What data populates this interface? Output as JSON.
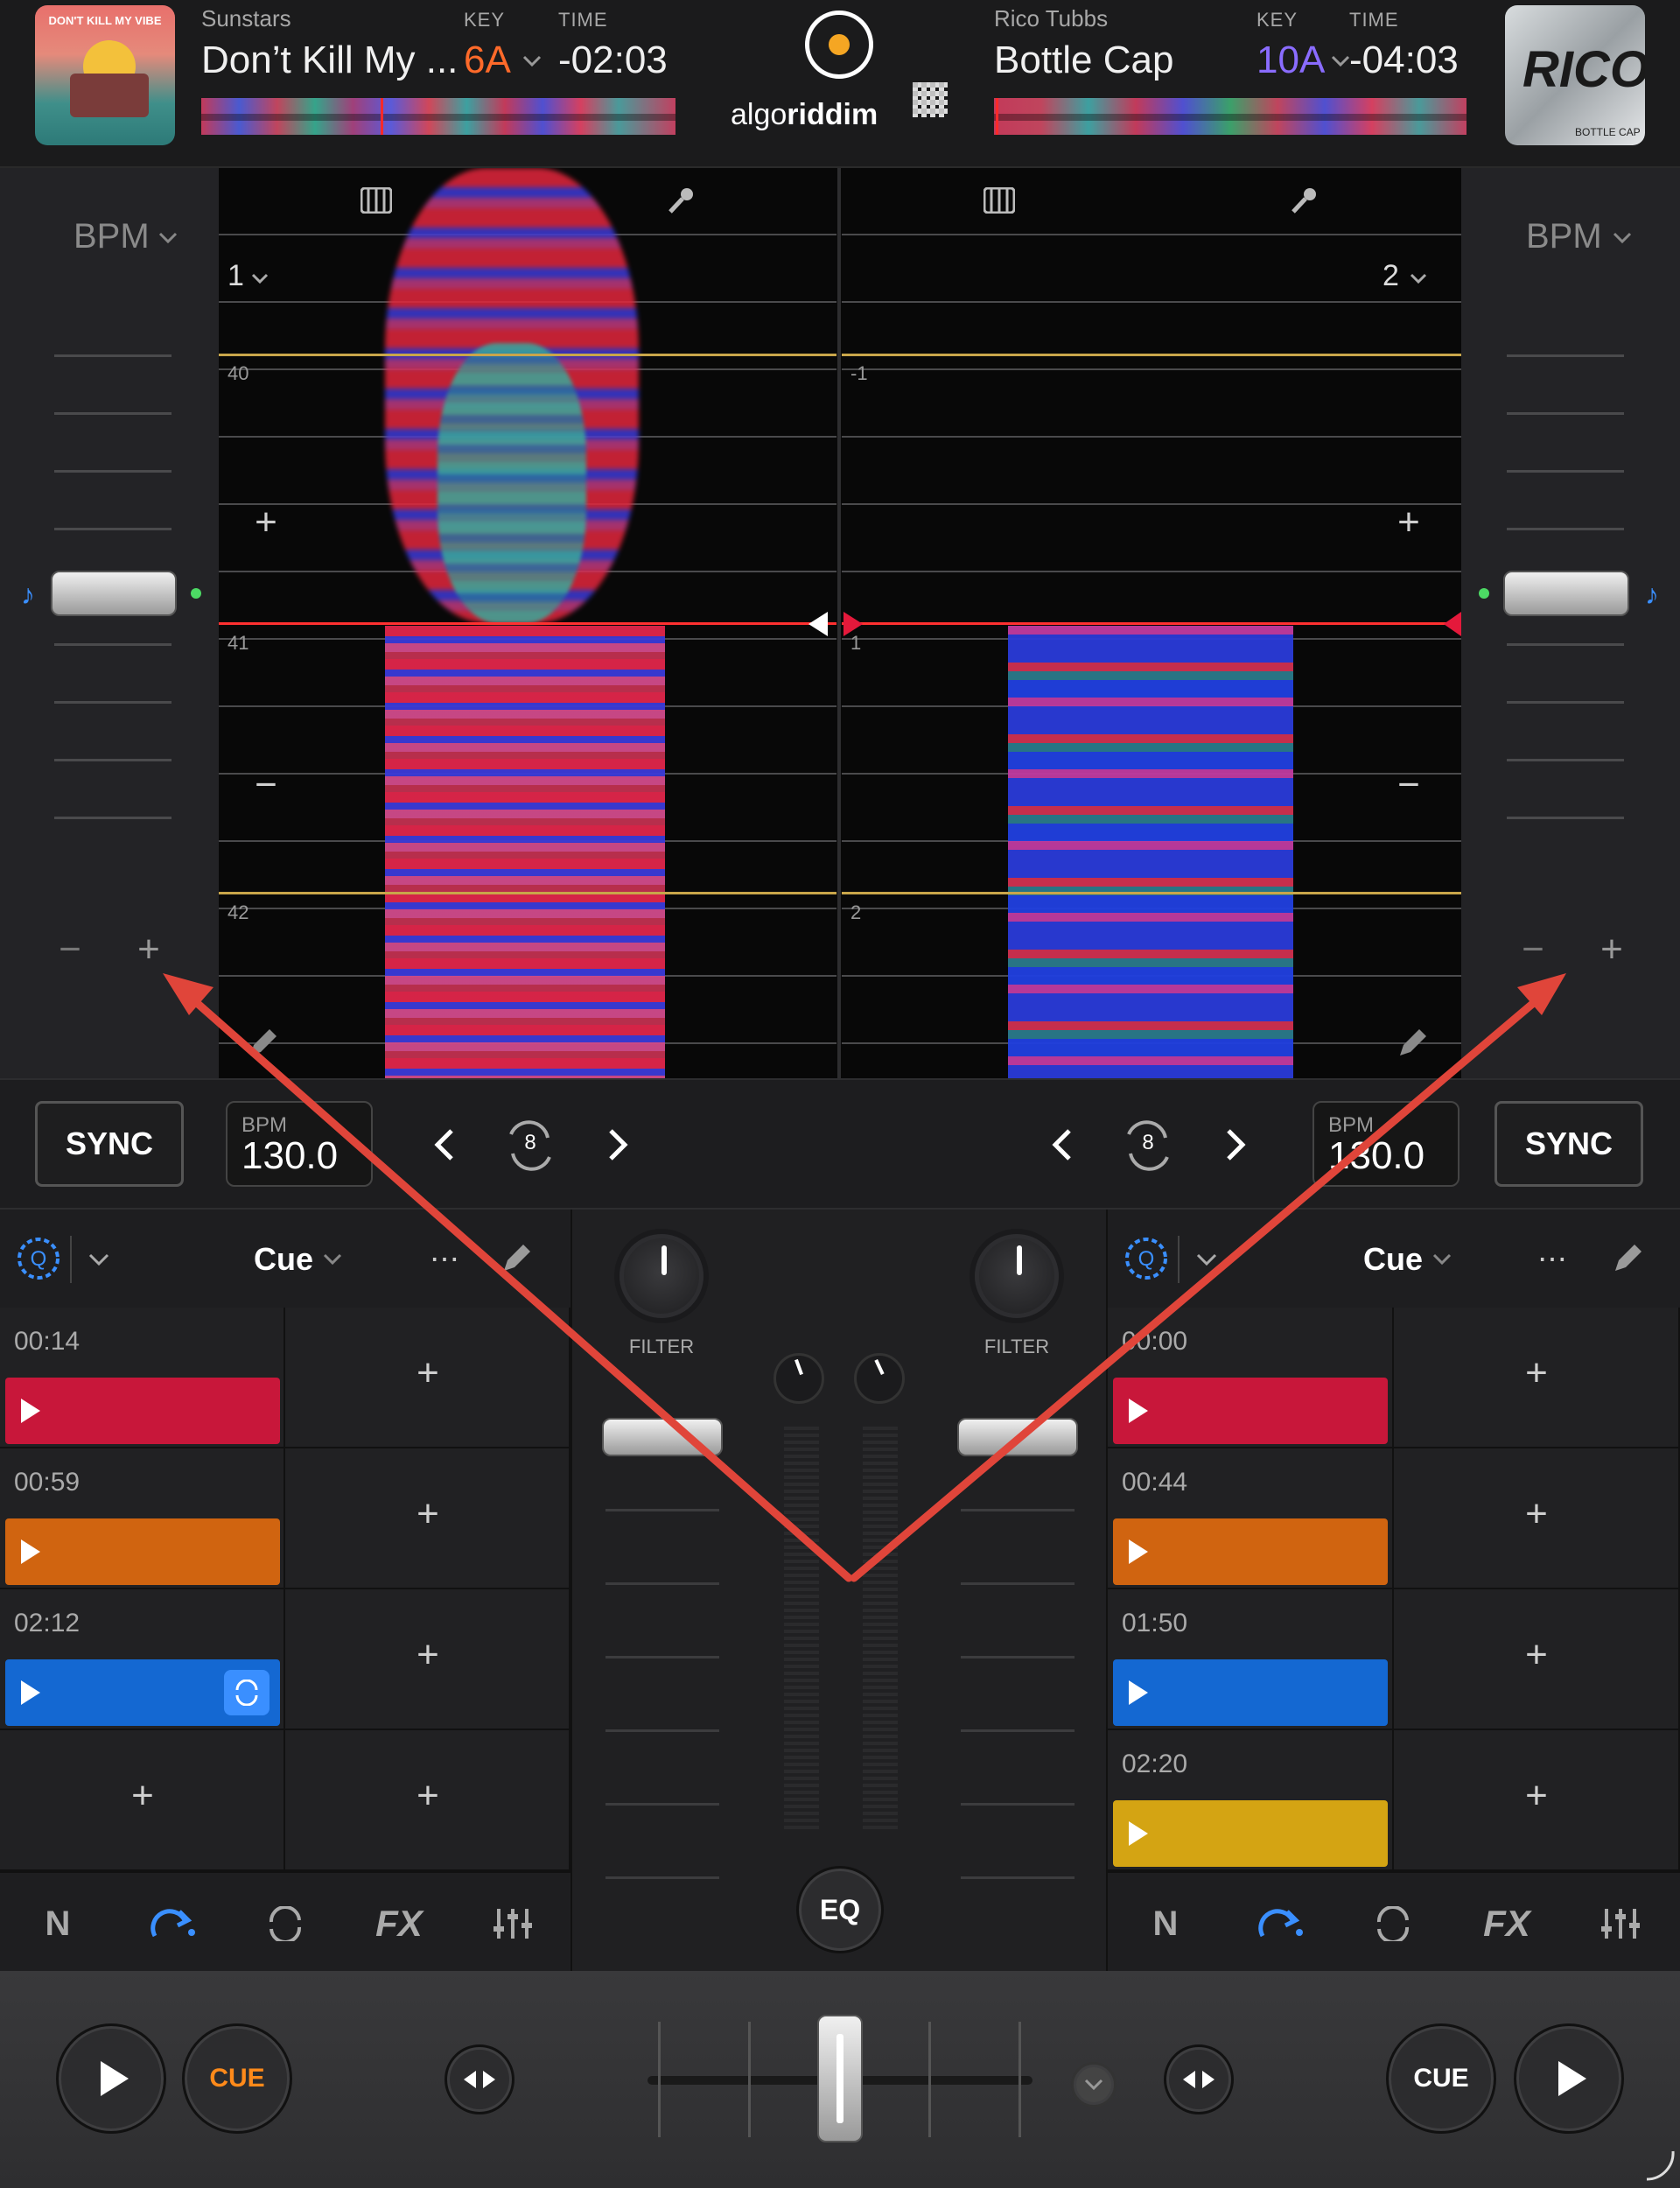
{
  "deckA": {
    "artist": "Sunstars",
    "title": "Don’t Kill My ...",
    "key_label": "KEY",
    "key": "6A",
    "time_label": "TIME",
    "time": "-02:03",
    "beat": "1",
    "grid_top": "40",
    "grid_mid": "41",
    "grid_bot": "42",
    "bpm_label": "BPM",
    "bpm": "130.0",
    "sync": "SYNC",
    "loop": "8",
    "cue_mode": "Cue",
    "art_text": "DON'T KILL MY VIBE",
    "cues": [
      {
        "time": "00:14",
        "color": "#c8173a"
      },
      {
        "time": "00:59",
        "color": "#d06410"
      },
      {
        "time": "02:12",
        "color": "#1468d2"
      }
    ],
    "filter": "FILTER",
    "cue_btn": "CUE"
  },
  "deckB": {
    "artist": "Rico Tubbs",
    "title": "Bottle Cap",
    "key_label": "KEY",
    "key": "10A",
    "time_label": "TIME",
    "time": "-04:03",
    "beat": "2",
    "grid_top": "-1",
    "grid_mid": "1",
    "grid_bot": "2",
    "bpm_label": "BPM",
    "bpm": "130.0",
    "sync": "SYNC",
    "loop": "8",
    "cue_mode": "Cue",
    "art_text": "BOTTLE CAP",
    "art_logo": "RICO",
    "cues": [
      {
        "time": "00:00",
        "color": "#c8173a"
      },
      {
        "time": "00:44",
        "color": "#d06410"
      },
      {
        "time": "01:50",
        "color": "#1468d2"
      },
      {
        "time": "02:20",
        "color": "#d4a413"
      }
    ],
    "filter": "FILTER",
    "cue_btn": "CUE"
  },
  "brand": {
    "logo_a": "algo",
    "logo_b": "riddim"
  },
  "side": {
    "bpm_label": "BPM"
  },
  "mixer": {
    "eq": "EQ"
  },
  "colors": {
    "accent_orange": "#ff6a2a",
    "key_b": "#8a6cff",
    "blue": "#3a8fff",
    "arrow": "#e0453a"
  },
  "icons": [
    "piano-icon",
    "mic-icon",
    "pencil-icon",
    "quantize-icon",
    "more-icon",
    "n-icon",
    "redo-icon",
    "loop-icon",
    "fx-icon",
    "sliders-icon",
    "play-icon",
    "nudge-icon"
  ]
}
